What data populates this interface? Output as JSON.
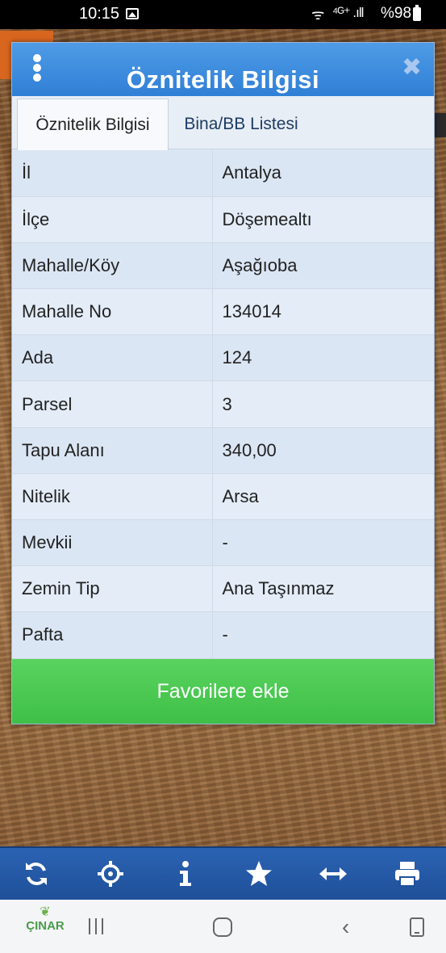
{
  "status_bar": {
    "time": "10:15",
    "wifi": "ᯤ",
    "signal": "⁴ᴳ⁺ .ıll",
    "battery": "%98"
  },
  "dialog": {
    "title": "Öznitelik Bilgisi",
    "tabs": [
      {
        "label": "Öznitelik Bilgisi",
        "active": true
      },
      {
        "label": "Bina/BB Listesi",
        "active": false
      }
    ],
    "rows": [
      {
        "key": "İl",
        "value": "Antalya"
      },
      {
        "key": "İlçe",
        "value": "Döşemealtı"
      },
      {
        "key": "Mahalle/Köy",
        "value": "Aşağıoba"
      },
      {
        "key": "Mahalle No",
        "value": "134014"
      },
      {
        "key": "Ada",
        "value": "124"
      },
      {
        "key": "Parsel",
        "value": "3"
      },
      {
        "key": "Tapu Alanı",
        "value": "340,00"
      },
      {
        "key": "Nitelik",
        "value": "Arsa"
      },
      {
        "key": "Mevkii",
        "value": "-"
      },
      {
        "key": "Zemin Tip",
        "value": "Ana Taşınmaz"
      },
      {
        "key": "Pafta",
        "value": "-"
      }
    ],
    "favorite_button": "Favorilere ekle",
    "close_glyph": "✖"
  },
  "toolbar": {
    "icons": [
      "refresh-icon",
      "crosshair-icon",
      "info-icon",
      "star-icon",
      "measure-icon",
      "print-icon"
    ]
  },
  "navbar": {
    "logo_text": "ÇINAR",
    "back_glyph": "‹"
  },
  "colors": {
    "header_blue": "#2f7fd6",
    "button_green": "#3fbf47",
    "toolbar_blue": "#1f5099"
  }
}
